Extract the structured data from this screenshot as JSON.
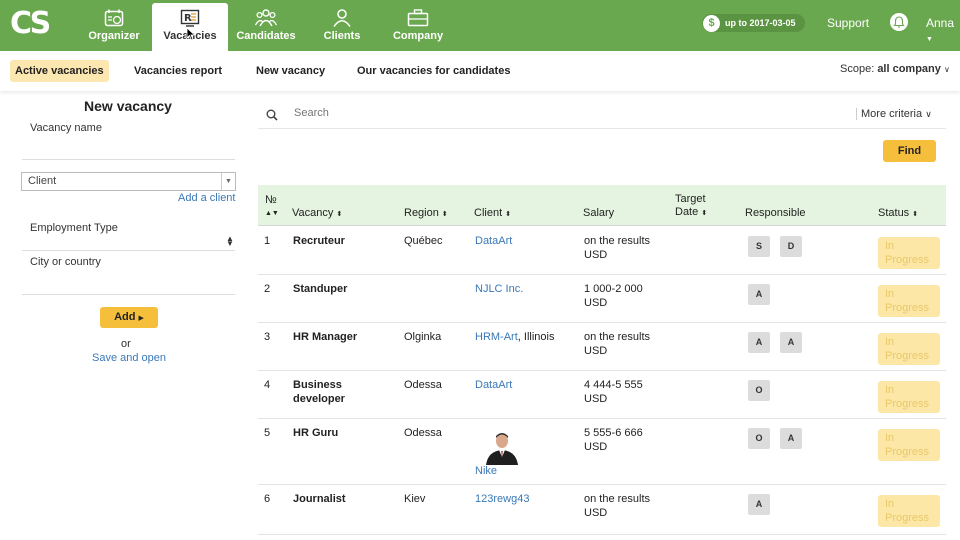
{
  "app": {
    "logo": "CS"
  },
  "nav": [
    {
      "label": "Organizer",
      "icon": "organizer-icon"
    },
    {
      "label": "Vacancies",
      "icon": "vacancies-icon",
      "active": true
    },
    {
      "label": "Candidates",
      "icon": "candidates-icon"
    },
    {
      "label": "Clients",
      "icon": "clients-icon"
    },
    {
      "label": "Company",
      "icon": "company-icon"
    }
  ],
  "header": {
    "plan": "up to 2017-03-05",
    "coin": "$",
    "support": "Support",
    "user": "Anna"
  },
  "subnav": {
    "tabs": [
      "Active vacancies",
      "Vacancies report",
      "New vacancy",
      "Our vacancies for candidates"
    ],
    "scope_label": "Scope:",
    "scope_value": "all company"
  },
  "form": {
    "title": "New vacancy",
    "vacancy_name": "Vacancy name",
    "client": "Client",
    "add_client": "Add a client",
    "employment_type": "Employment Type",
    "city": "City or country",
    "add_button": "Add",
    "or": "or",
    "save_open": "Save and open"
  },
  "search": {
    "placeholder": "Search",
    "more": "More criteria",
    "find": "Find"
  },
  "table": {
    "headers": {
      "no": "№",
      "vacancy": "Vacancy",
      "region": "Region",
      "client": "Client",
      "salary": "Salary",
      "target_line1": "Target",
      "target_line2": "Date",
      "responsible": "Responsible",
      "status": "Status"
    },
    "rows": [
      {
        "no": "1",
        "vacancy": "Recruteur",
        "vacancy2": "",
        "region": "Québec",
        "client": "DataArt",
        "client_extra": "",
        "salary1": "on the results",
        "salary2": "USD",
        "resp": [
          "S",
          "D"
        ],
        "status1": "In",
        "status2": "Progress"
      },
      {
        "no": "2",
        "vacancy": "Standuper",
        "vacancy2": "",
        "region": "",
        "client": "NJLC Inc.",
        "client_extra": "",
        "salary1": "1 000-2 000",
        "salary2": "USD",
        "resp": [
          "A"
        ],
        "status1": "In",
        "status2": "Progress"
      },
      {
        "no": "3",
        "vacancy": "HR Manager",
        "vacancy2": "",
        "region": "Olginka",
        "client": "HRM-Art",
        "client_extra": ", Illinois",
        "salary1": "on the results",
        "salary2": "USD",
        "resp": [
          "A",
          "A"
        ],
        "status1": "In",
        "status2": "Progress"
      },
      {
        "no": "4",
        "vacancy": "Business",
        "vacancy2": "developer",
        "region": "Odessa",
        "client": "DataArt",
        "client_extra": "",
        "salary1": "4 444-5 555",
        "salary2": "USD",
        "resp": [
          "O"
        ],
        "status1": "In",
        "status2": "Progress"
      },
      {
        "no": "5",
        "vacancy": "HR Guru",
        "vacancy2": "",
        "region": "Odessa",
        "client": "Nike",
        "client_extra": "",
        "salary1": "5 555-6 666",
        "salary2": "USD",
        "resp": [
          "O",
          "A"
        ],
        "status1": "In",
        "status2": "Progress"
      },
      {
        "no": "6",
        "vacancy": "Journalist",
        "vacancy2": "",
        "region": "Kiev",
        "client": "123rewg43",
        "client_extra": "",
        "salary1": "on the results",
        "salary2": "USD",
        "resp": [
          "A"
        ],
        "status1": "In",
        "status2": "Progress"
      }
    ]
  }
}
